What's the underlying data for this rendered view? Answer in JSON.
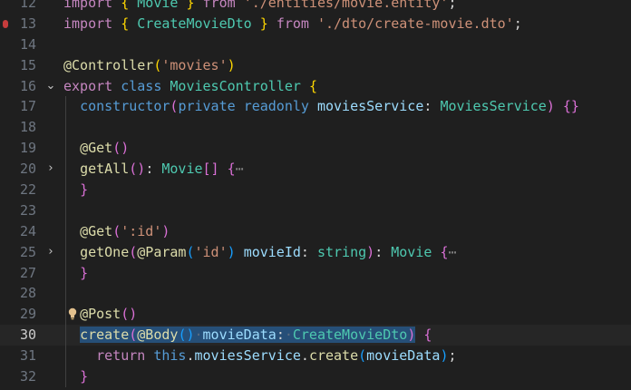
{
  "editor": {
    "active_line": 30,
    "lines": [
      {
        "n": "12",
        "fold": "",
        "breakpoint": false,
        "guide": false,
        "bulb": false,
        "tokens": [
          [
            "kw",
            "import"
          ],
          [
            "plain",
            " "
          ],
          [
            "br1",
            "{"
          ],
          [
            "plain",
            " "
          ],
          [
            "type",
            "Movie"
          ],
          [
            "plain",
            " "
          ],
          [
            "br1",
            "}"
          ],
          [
            "plain",
            " "
          ],
          [
            "kw",
            "from"
          ],
          [
            "plain",
            " "
          ],
          [
            "str",
            "'./entities/movie.entity'"
          ],
          [
            "plain",
            ";"
          ]
        ]
      },
      {
        "n": "13",
        "fold": "",
        "breakpoint": true,
        "guide": false,
        "bulb": false,
        "tokens": [
          [
            "kw",
            "import"
          ],
          [
            "plain",
            " "
          ],
          [
            "br1",
            "{"
          ],
          [
            "plain",
            " "
          ],
          [
            "type",
            "CreateMovieDto"
          ],
          [
            "plain",
            " "
          ],
          [
            "br1",
            "}"
          ],
          [
            "plain",
            " "
          ],
          [
            "kw",
            "from"
          ],
          [
            "plain",
            " "
          ],
          [
            "str",
            "'./dto/create-movie.dto'"
          ],
          [
            "plain",
            ";"
          ]
        ]
      },
      {
        "n": "14",
        "fold": "",
        "breakpoint": false,
        "guide": false,
        "bulb": false,
        "tokens": []
      },
      {
        "n": "15",
        "fold": "",
        "breakpoint": false,
        "guide": false,
        "bulb": false,
        "tokens": [
          [
            "dec",
            "@Controller"
          ],
          [
            "br1",
            "("
          ],
          [
            "str",
            "'movies'"
          ],
          [
            "br1",
            ")"
          ]
        ]
      },
      {
        "n": "16",
        "fold": "⌄",
        "breakpoint": false,
        "guide": false,
        "bulb": false,
        "tokens": [
          [
            "kw",
            "export"
          ],
          [
            "plain",
            " "
          ],
          [
            "storage",
            "class"
          ],
          [
            "plain",
            " "
          ],
          [
            "type",
            "MoviesController"
          ],
          [
            "plain",
            " "
          ],
          [
            "br1",
            "{"
          ]
        ]
      },
      {
        "n": "17",
        "fold": "",
        "breakpoint": false,
        "guide": true,
        "bulb": false,
        "tokens": [
          [
            "plain",
            "  "
          ],
          [
            "storage",
            "constructor"
          ],
          [
            "br2",
            "("
          ],
          [
            "storage",
            "private"
          ],
          [
            "plain",
            " "
          ],
          [
            "storage",
            "readonly"
          ],
          [
            "plain",
            " "
          ],
          [
            "var",
            "moviesService"
          ],
          [
            "plain",
            ": "
          ],
          [
            "type",
            "MoviesService"
          ],
          [
            "br2",
            ")"
          ],
          [
            "plain",
            " "
          ],
          [
            "br2",
            "{}"
          ]
        ]
      },
      {
        "n": "18",
        "fold": "",
        "breakpoint": false,
        "guide": true,
        "bulb": false,
        "tokens": []
      },
      {
        "n": "19",
        "fold": "",
        "breakpoint": false,
        "guide": true,
        "bulb": false,
        "tokens": [
          [
            "plain",
            "  "
          ],
          [
            "dec",
            "@Get"
          ],
          [
            "br2",
            "()"
          ]
        ]
      },
      {
        "n": "20",
        "fold": "›",
        "breakpoint": false,
        "guide": true,
        "bulb": false,
        "folded": true,
        "tokens": [
          [
            "plain",
            "  "
          ],
          [
            "fn",
            "getAll"
          ],
          [
            "br2",
            "()"
          ],
          [
            "plain",
            ": "
          ],
          [
            "type",
            "Movie"
          ],
          [
            "br2",
            "[]"
          ],
          [
            "plain",
            " "
          ],
          [
            "br2",
            "{"
          ],
          [
            "fold",
            "⋯"
          ]
        ]
      },
      {
        "n": "22",
        "fold": "",
        "breakpoint": false,
        "guide": true,
        "bulb": false,
        "tokens": [
          [
            "plain",
            "  "
          ],
          [
            "br2",
            "}"
          ]
        ]
      },
      {
        "n": "23",
        "fold": "",
        "breakpoint": false,
        "guide": true,
        "bulb": false,
        "tokens": []
      },
      {
        "n": "24",
        "fold": "",
        "breakpoint": false,
        "guide": true,
        "bulb": false,
        "tokens": [
          [
            "plain",
            "  "
          ],
          [
            "dec",
            "@Get"
          ],
          [
            "br2",
            "("
          ],
          [
            "str",
            "':id'"
          ],
          [
            "br2",
            ")"
          ]
        ]
      },
      {
        "n": "25",
        "fold": "›",
        "breakpoint": false,
        "guide": true,
        "bulb": false,
        "folded": true,
        "tokens": [
          [
            "plain",
            "  "
          ],
          [
            "fn",
            "getOne"
          ],
          [
            "br2",
            "("
          ],
          [
            "dec",
            "@Param"
          ],
          [
            "br3",
            "("
          ],
          [
            "str",
            "'id'"
          ],
          [
            "br3",
            ")"
          ],
          [
            "plain",
            " "
          ],
          [
            "var",
            "movieId"
          ],
          [
            "plain",
            ": "
          ],
          [
            "type",
            "string"
          ],
          [
            "br2",
            ")"
          ],
          [
            "plain",
            ": "
          ],
          [
            "type",
            "Movie"
          ],
          [
            "plain",
            " "
          ],
          [
            "br2",
            "{"
          ],
          [
            "fold",
            "⋯"
          ]
        ]
      },
      {
        "n": "27",
        "fold": "",
        "breakpoint": false,
        "guide": true,
        "bulb": false,
        "tokens": [
          [
            "plain",
            "  "
          ],
          [
            "br2",
            "}"
          ]
        ]
      },
      {
        "n": "28",
        "fold": "",
        "breakpoint": false,
        "guide": true,
        "bulb": false,
        "tokens": []
      },
      {
        "n": "29",
        "fold": "",
        "breakpoint": false,
        "guide": true,
        "bulb": true,
        "tokens": [
          [
            "plain",
            "  "
          ],
          [
            "dec",
            "@Post"
          ],
          [
            "br2",
            "()"
          ]
        ]
      },
      {
        "n": "30",
        "fold": "",
        "breakpoint": false,
        "guide": true,
        "bulb": false,
        "tokens": [
          [
            "plain",
            "  "
          ],
          [
            "fn",
            "create",
            true
          ],
          [
            "br2",
            "(",
            true
          ],
          [
            "dec",
            "@Body",
            true
          ],
          [
            "br3",
            "()",
            true
          ],
          [
            "ws",
            "·",
            true
          ],
          [
            "var",
            "movieData",
            true
          ],
          [
            "plain",
            ":",
            true
          ],
          [
            "ws",
            "·",
            true
          ],
          [
            "type",
            "CreateMovieDto",
            true
          ],
          [
            "br2",
            ")",
            true
          ],
          [
            "plain",
            " "
          ],
          [
            "br2",
            "{"
          ]
        ]
      },
      {
        "n": "31",
        "fold": "",
        "breakpoint": false,
        "guide": true,
        "bulb": false,
        "tokens": [
          [
            "plain",
            "    "
          ],
          [
            "kw",
            "return"
          ],
          [
            "plain",
            " "
          ],
          [
            "storage",
            "this"
          ],
          [
            "plain",
            "."
          ],
          [
            "var",
            "moviesService"
          ],
          [
            "plain",
            "."
          ],
          [
            "fn",
            "create"
          ],
          [
            "br3",
            "("
          ],
          [
            "var",
            "movieData"
          ],
          [
            "br3",
            ")"
          ],
          [
            "plain",
            ";"
          ]
        ]
      },
      {
        "n": "32",
        "fold": "",
        "breakpoint": false,
        "guide": true,
        "bulb": false,
        "tokens": [
          [
            "plain",
            "  "
          ],
          [
            "br2",
            "}"
          ]
        ]
      }
    ]
  }
}
